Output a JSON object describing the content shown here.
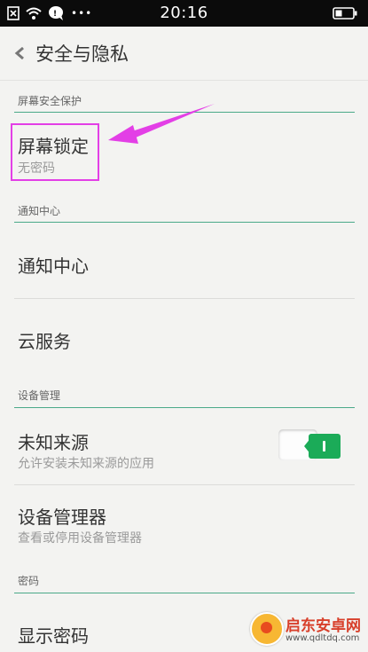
{
  "status_bar": {
    "time": "20:16",
    "icons": [
      "sim-card-icon",
      "wifi-icon",
      "chat-icon",
      "more-icon",
      "battery-icon"
    ],
    "dots": "•••"
  },
  "header": {
    "title": "安全与隐私"
  },
  "sections": {
    "screen_security": {
      "label": "屏幕安全保护",
      "items": {
        "screen_lock": {
          "title": "屏幕锁定",
          "subtitle": "无密码"
        }
      }
    },
    "notifications": {
      "label": "通知中心",
      "items": {
        "notification_center": {
          "title": "通知中心"
        },
        "cloud_service": {
          "title": "云服务"
        }
      }
    },
    "device_management": {
      "label": "设备管理",
      "items": {
        "unknown_sources": {
          "title": "未知来源",
          "subtitle": "允许安装未知来源的应用",
          "toggle_on": true
        },
        "device_admin": {
          "title": "设备管理器",
          "subtitle": "查看或停用设备管理器"
        }
      }
    },
    "password": {
      "label": "密码",
      "items": {
        "show_password": {
          "title": "显示密码"
        }
      }
    }
  },
  "watermark": {
    "title": "启东安卓网",
    "url": "www.qdltdq.com"
  },
  "colors": {
    "accent": "#4aa989",
    "toggle_on": "#1bab58",
    "highlight": "#e33fe6"
  }
}
